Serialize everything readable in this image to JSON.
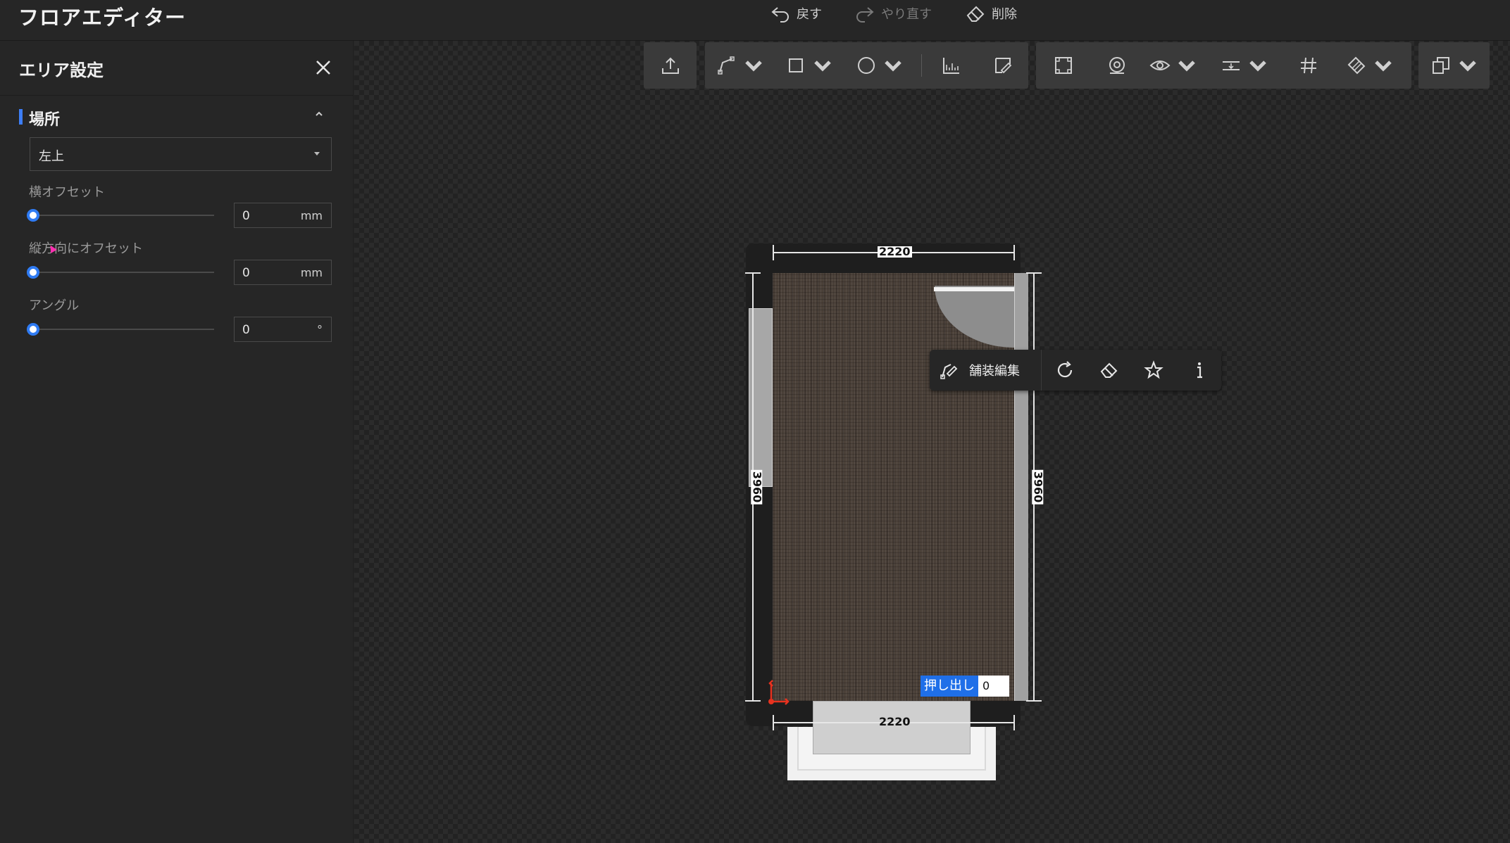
{
  "header": {
    "app_title": "フロアエディター",
    "undo_label": "戻す",
    "redo_label": "やり直す",
    "delete_label": "削除"
  },
  "panel": {
    "title": "エリア設定",
    "section_title": "場所",
    "location_select": {
      "value": "左上"
    },
    "fields": [
      {
        "label": "横オフセット",
        "value": "0",
        "unit": "mm",
        "slider_value": 0
      },
      {
        "label": "縦方向にオフセット",
        "value": "0",
        "unit": "mm",
        "slider_value": 0
      },
      {
        "label": "アングル",
        "value": "0",
        "unit": "°",
        "slider_value": 0
      }
    ]
  },
  "toolbar": {
    "icons": [
      "upload-icon",
      "draw-wall-icon",
      "rectangle-icon",
      "circle-icon",
      "ruler-icon",
      "edit-icon",
      "select-area-icon",
      "camera-view-icon",
      "eye-icon",
      "align-icon",
      "grid-icon",
      "paint-icon",
      "copy-icon"
    ]
  },
  "canvas": {
    "dimensions": {
      "top_width": "2220",
      "bottom_width": "2220",
      "left_height": "3960",
      "right_height": "3960"
    },
    "context_menu": {
      "edit_label": "舗装編集",
      "icons": [
        "refresh-icon",
        "eraser-icon",
        "star-icon",
        "info-icon"
      ]
    },
    "extrude": {
      "label": "押し出し",
      "value": "0"
    }
  },
  "colors": {
    "accent": "#3d7ef7",
    "extrude_bg": "#1f6fe8",
    "origin_marker": "#e8321f"
  }
}
